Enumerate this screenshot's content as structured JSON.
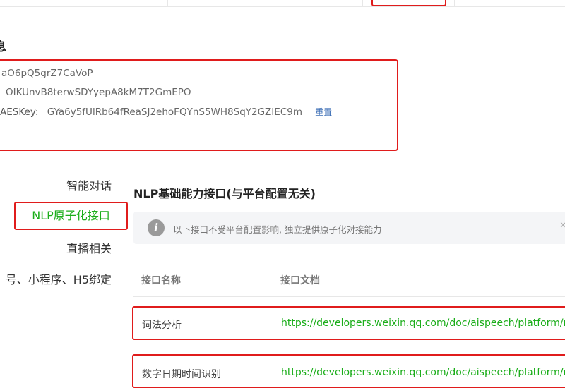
{
  "section": {
    "title": "息"
  },
  "credentials": {
    "appid": "aO6pQ5grZ7CaVoP",
    "token": "OIKUnvB8terwSDYyepA8kM7T2GmEPO",
    "aeskey_label": "AESKey:",
    "aeskey": "GYa6y5fUlRb64fReaSJ2ehoFQYnS5WH8SqY2GZIEC9m",
    "reset_label": "重置"
  },
  "nav": {
    "items": [
      {
        "label": "智能对话"
      },
      {
        "label": "NLP原子化接口"
      },
      {
        "label": "直播相关"
      },
      {
        "label": "号、小程序、H5绑定"
      }
    ]
  },
  "panel": {
    "title": "NLP基础能力接口(与平台配置无关)",
    "notice": "以下接口不受平台配置影响, 独立提供原子化对接能力",
    "notice_icon": "info-icon",
    "close_glyph": "×",
    "columns": [
      "接口名称",
      "接口文档"
    ],
    "rows": [
      {
        "name": "词法分析",
        "doc": "https://developers.weixin.qq.com/doc/aispeech/platform/nlp"
      },
      {
        "name": "数字日期时间识别",
        "doc": "https://developers.weixin.qq.com/doc/aispeech/platform/nlp"
      }
    ]
  },
  "colors": {
    "highlight": "#e01c1c",
    "active_green": "#1aad19",
    "link_blue": "#3b6db5"
  }
}
